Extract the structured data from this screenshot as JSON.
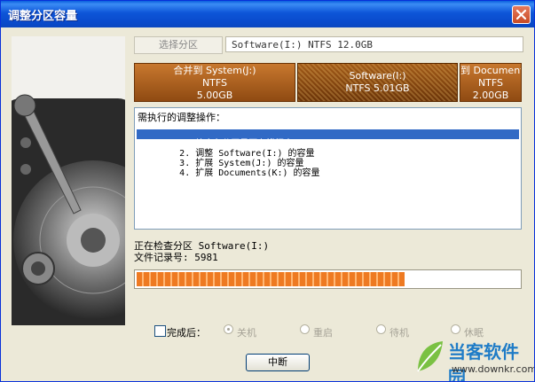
{
  "window": {
    "title": "调整分区容量"
  },
  "partition_selector": {
    "button_label": "选择分区",
    "info": "Software(I:) NTFS 12.0GB"
  },
  "partitions": [
    {
      "name": "合并到 System(J:)",
      "fs": "NTFS",
      "size": "5.00GB"
    },
    {
      "name": "Software(I:)",
      "fs": "NTFS",
      "size": "5.01GB"
    },
    {
      "name": "到 Document",
      "fs": "NTFS",
      "size": "2.00GB"
    }
  ],
  "operations": {
    "title": "需执行的调整操作：",
    "items": [
      {
        "text": "1. 检查各分区是否有错误",
        "status": "执行中",
        "selected": true
      },
      {
        "text": "2. 调整 Software(I:) 的容量",
        "status": "",
        "selected": false
      },
      {
        "text": "3. 扩展 System(J:) 的容量",
        "status": "",
        "selected": false
      },
      {
        "text": "4. 扩展 Documents(K:) 的容量",
        "status": "",
        "selected": false
      }
    ]
  },
  "status": {
    "line1": "正在检查分区 Software(I:)",
    "line2": "文件记录号: 5981"
  },
  "progress": {
    "value": 0.7
  },
  "after_complete": {
    "checkbox_label": "完成后：",
    "options": [
      "关机",
      "重启",
      "待机",
      "休眠"
    ],
    "selected_index": 0
  },
  "abort_button": "中断",
  "watermark": {
    "text": "当客软件园",
    "url": "www.downkr.com"
  },
  "colors": {
    "titlebar": "#0a4bcc",
    "selected_row": "#316ac5",
    "progress_fill": "#ee7a22",
    "partition_fill": "#a15a18"
  },
  "icons": {
    "close": "close-icon",
    "disk": "hard-disk-icon"
  }
}
